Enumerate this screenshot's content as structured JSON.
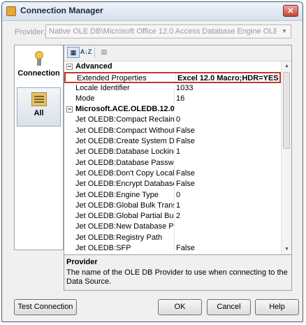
{
  "window": {
    "title": "Connection Manager",
    "close_glyph": "✕"
  },
  "provider": {
    "label": "Provider:",
    "value": "Native OLE DB\\Microsoft Office 12.0 Access Database Engine OLE DB Provider"
  },
  "sidebar": {
    "items": [
      {
        "label": "Connection",
        "icon": "connection-icon"
      },
      {
        "label": "All",
        "icon": "all-properties-icon",
        "selected": true
      }
    ]
  },
  "toolbar": {
    "categorized_glyph": "▦",
    "alphabetical_glyph": "A↓Z",
    "pages_glyph": "▤"
  },
  "grid": {
    "rows": [
      {
        "kind": "category",
        "label": "Advanced"
      },
      {
        "kind": "property",
        "name": "Extended Properties",
        "value": "Excel 12.0 Macro;HDR=YES",
        "highlight": true
      },
      {
        "kind": "property",
        "name": "Locale Identifier",
        "value": "1033"
      },
      {
        "kind": "property",
        "name": "Mode",
        "value": "16"
      },
      {
        "kind": "category",
        "label": "Microsoft.ACE.OLEDB.12.0"
      },
      {
        "kind": "property",
        "name": "Jet OLEDB:Compact Reclaimed Sp",
        "value": "0"
      },
      {
        "kind": "property",
        "name": "Jet OLEDB:Compact Without Repl",
        "value": "False"
      },
      {
        "kind": "property",
        "name": "Jet OLEDB:Create System Databas",
        "value": "False"
      },
      {
        "kind": "property",
        "name": "Jet OLEDB:Database Locking Moc",
        "value": "1"
      },
      {
        "kind": "property",
        "name": "Jet OLEDB:Database Password",
        "value": ""
      },
      {
        "kind": "property",
        "name": "Jet OLEDB:Don't Copy Locale on (",
        "value": "False"
      },
      {
        "kind": "property",
        "name": "Jet OLEDB:Encrypt Database",
        "value": "False"
      },
      {
        "kind": "property",
        "name": "Jet OLEDB:Engine Type",
        "value": "0"
      },
      {
        "kind": "property",
        "name": "Jet OLEDB:Global Bulk Transactio",
        "value": "1"
      },
      {
        "kind": "property",
        "name": "Jet OLEDB:Global Partial Bulk Op:",
        "value": "2"
      },
      {
        "kind": "property",
        "name": "Jet OLEDB:New Database Passwo",
        "value": ""
      },
      {
        "kind": "property",
        "name": "Jet OLEDB:Registry Path",
        "value": ""
      },
      {
        "kind": "property",
        "name": "Jet OLEDB:SFP",
        "value": "False"
      }
    ]
  },
  "description": {
    "title": "Provider",
    "text": "The name of the OLE DB Provider to use when connecting to the Data Source."
  },
  "buttons": {
    "test": "Test Connection",
    "ok": "OK",
    "cancel": "Cancel",
    "help": "Help"
  },
  "colors": {
    "highlight_border": "#c0392b"
  }
}
